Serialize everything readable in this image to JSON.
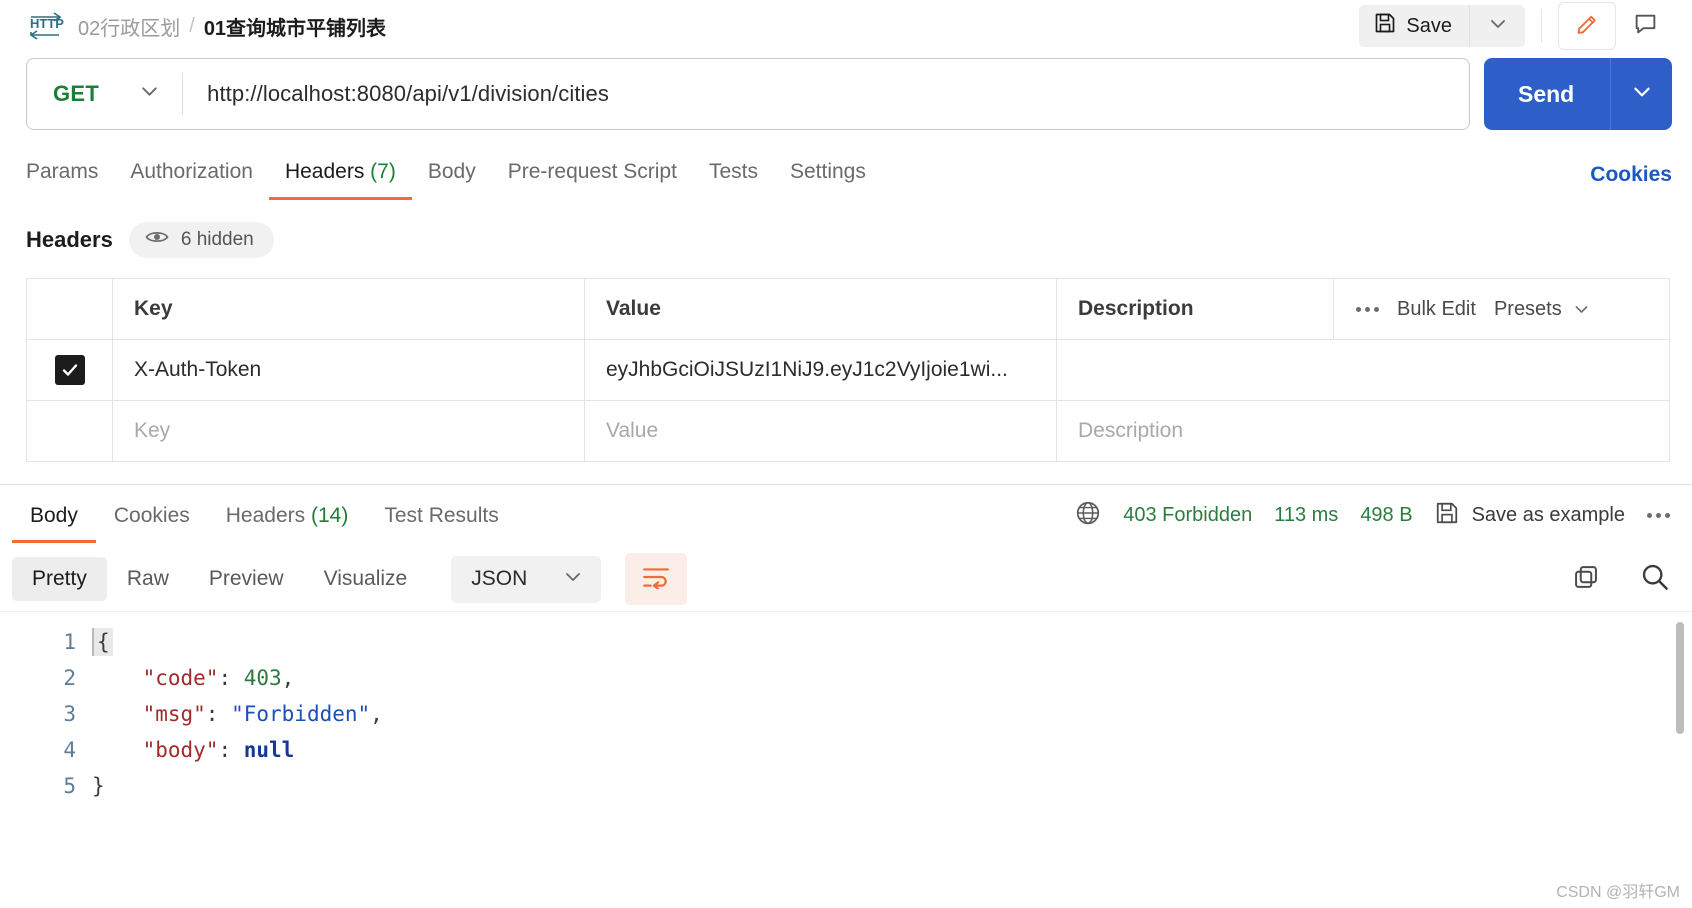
{
  "topbar": {
    "protocol_icon": "http-icon",
    "breadcrumb_parent": "02行政区划",
    "breadcrumb_sep": "/",
    "breadcrumb_current": "01查询城市平铺列表",
    "save_label": "Save",
    "save_icon": "floppy-disk-icon",
    "save_caret_icon": "chevron-down-icon",
    "edit_icon": "pencil-icon",
    "comment_icon": "comment-icon"
  },
  "request": {
    "method": "GET",
    "method_caret_icon": "chevron-down-icon",
    "url": "http://localhost:8080/api/v1/division/cities",
    "send_label": "Send",
    "send_caret_icon": "chevron-down-icon",
    "tabs": [
      {
        "label": "Params",
        "count": "",
        "active": false
      },
      {
        "label": "Authorization",
        "count": "",
        "active": false
      },
      {
        "label": "Headers",
        "count": "(7)",
        "active": true
      },
      {
        "label": "Body",
        "count": "",
        "active": false
      },
      {
        "label": "Pre-request Script",
        "count": "",
        "active": false
      },
      {
        "label": "Tests",
        "count": "",
        "active": false
      },
      {
        "label": "Settings",
        "count": "",
        "active": false
      }
    ],
    "cookies_link": "Cookies"
  },
  "headers_section": {
    "title": "Headers",
    "hidden_badge": "6 hidden",
    "eye_icon": "eye-icon",
    "columns": [
      "Key",
      "Value",
      "Description"
    ],
    "tools": {
      "more_icon": "more-horizontal-icon",
      "bulk_edit": "Bulk Edit",
      "presets": "Presets",
      "presets_caret_icon": "chevron-down-icon"
    },
    "rows": [
      {
        "checked": true,
        "key": "X-Auth-Token",
        "value": "eyJhbGciOiJSUzI1NiJ9.eyJ1c2VyIjoie1wi...",
        "description": ""
      }
    ],
    "empty_row": {
      "key_placeholder": "Key",
      "value_placeholder": "Value",
      "description_placeholder": "Description"
    }
  },
  "response": {
    "tabs": [
      {
        "label": "Body",
        "count": "",
        "active": true
      },
      {
        "label": "Cookies",
        "count": "",
        "active": false
      },
      {
        "label": "Headers",
        "count": "(14)",
        "active": false
      },
      {
        "label": "Test Results",
        "count": "",
        "active": false
      }
    ],
    "globe_icon": "globe-icon",
    "status": "403 Forbidden",
    "time": "113 ms",
    "size": "498 B",
    "save_example_icon": "floppy-disk-icon",
    "save_example": "Save as example",
    "more_icon": "more-horizontal-icon",
    "viewer": {
      "modes": [
        {
          "label": "Pretty",
          "active": true
        },
        {
          "label": "Raw",
          "active": false
        },
        {
          "label": "Preview",
          "active": false
        },
        {
          "label": "Visualize",
          "active": false
        }
      ],
      "format": "JSON",
      "format_caret_icon": "chevron-down-icon",
      "wrap_icon": "wrap-text-icon",
      "copy_icon": "copy-icon",
      "search_icon": "search-icon"
    },
    "body_lines": [
      {
        "n": "1",
        "tokens": [
          {
            "t": "{",
            "c": "punct-brace"
          }
        ]
      },
      {
        "n": "2",
        "tokens": [
          {
            "t": "    ",
            "c": "punct"
          },
          {
            "t": "\"code\"",
            "c": "key"
          },
          {
            "t": ": ",
            "c": "punct"
          },
          {
            "t": "403",
            "c": "num"
          },
          {
            "t": ",",
            "c": "punct"
          }
        ]
      },
      {
        "n": "3",
        "tokens": [
          {
            "t": "    ",
            "c": "punct"
          },
          {
            "t": "\"msg\"",
            "c": "key"
          },
          {
            "t": ": ",
            "c": "punct"
          },
          {
            "t": "\"Forbidden\"",
            "c": "str"
          },
          {
            "t": ",",
            "c": "punct"
          }
        ]
      },
      {
        "n": "4",
        "tokens": [
          {
            "t": "    ",
            "c": "punct"
          },
          {
            "t": "\"body\"",
            "c": "key"
          },
          {
            "t": ": ",
            "c": "punct"
          },
          {
            "t": "null",
            "c": "null"
          }
        ]
      },
      {
        "n": "5",
        "tokens": [
          {
            "t": "}",
            "c": "punct"
          }
        ]
      }
    ]
  },
  "watermark": "CSDN @羽轩GM",
  "colors": {
    "accent_orange": "#f06c35",
    "send_blue": "#2e5fc9",
    "link_blue": "#1d57c4",
    "status_green": "#2a7d3f",
    "method_green": "#1a7f37"
  }
}
